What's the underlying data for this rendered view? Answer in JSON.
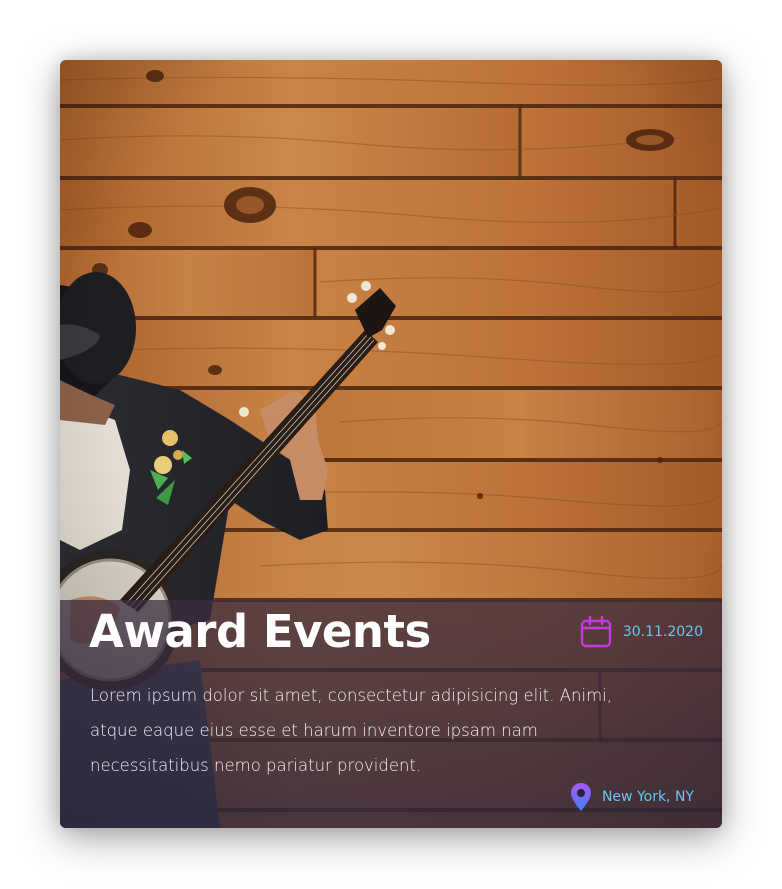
{
  "event": {
    "title": "Award Events",
    "date": "30.11.2020",
    "description": "Lorem ipsum dolor sit amet, consectetur adipisicing elit. Animi, atque eaque eius esse et harum inventore ipsam  nam necessitatibus nemo pariatur provident.",
    "location": "New York, NY"
  },
  "icons": {
    "date": "calendar-icon",
    "location": "map-pin-icon"
  },
  "colors": {
    "accent_text": "#66c6f5",
    "icon_gradient_start": "#c026d3",
    "icon_gradient_end": "#3b82f6",
    "overlay": "#3a2c3e",
    "wood": "#b8743a"
  }
}
